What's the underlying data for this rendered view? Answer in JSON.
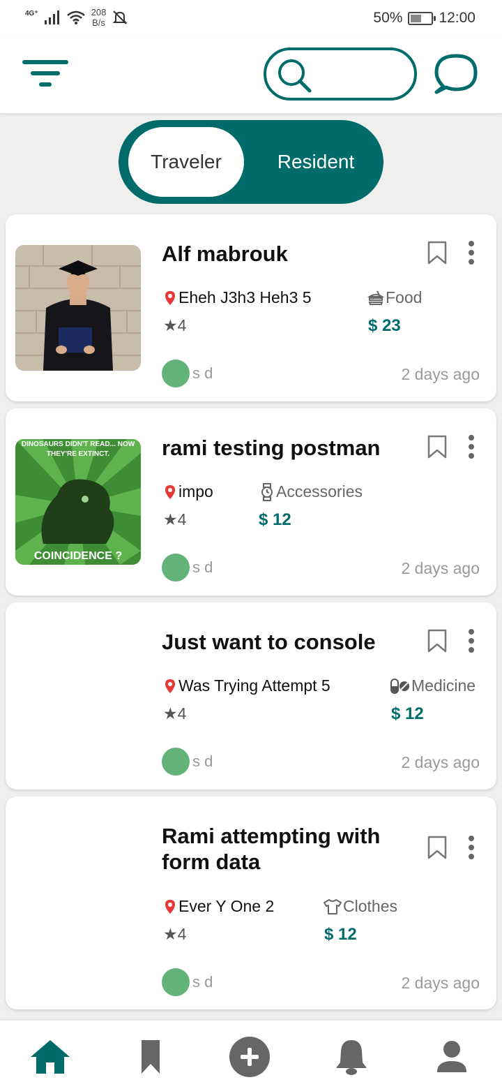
{
  "status_bar": {
    "network": "4G⁺",
    "speed_value": "208",
    "speed_unit": "B/s",
    "battery": "50%",
    "battery_level": 0.5,
    "time": "12:00"
  },
  "header": {
    "filter_icon": "filter-icon",
    "search_icon": "search-icon",
    "search_value": "",
    "chat_icon": "chat-icon"
  },
  "toggle": {
    "options": [
      "Traveler",
      "Resident"
    ],
    "selected": "Traveler"
  },
  "posts": [
    {
      "title": "Alf mabrouk",
      "location": "Eheh J3h3 Heh3 5",
      "category": "Food",
      "category_icon": "food-icon",
      "rating": "★4",
      "price": "$ 23",
      "user": "s d",
      "time": "2 days ago",
      "thumbnail": "graduate-photo"
    },
    {
      "title": "rami testing postman",
      "location": "impo",
      "category": "Accessories",
      "category_icon": "watch-icon",
      "rating": "★4",
      "price": "$ 12",
      "user": "s d",
      "time": "2 days ago",
      "thumbnail": "meme-image",
      "meme_top": "DINOSAURS DIDN'T READ... NOW THEY'RE EXTINCT.",
      "meme_bottom": "COINCIDENCE ?"
    },
    {
      "title": "Just want to console",
      "location": "Was Trying Attempt 5",
      "category": "Medicine",
      "category_icon": "pill-icon",
      "rating": "★4",
      "price": "$ 12",
      "user": "s d",
      "time": "2 days ago"
    },
    {
      "title": "Rami attempting with form data",
      "location": "Ever Y One 2",
      "category": "Clothes",
      "category_icon": "shirt-icon",
      "rating": "★4",
      "price": "$ 12",
      "user": "s d",
      "time": "2 days ago"
    }
  ],
  "bottom_nav": [
    {
      "name": "home",
      "icon": "home-icon",
      "active": true
    },
    {
      "name": "saved",
      "icon": "bookmark-icon",
      "active": false
    },
    {
      "name": "add",
      "icon": "add-icon",
      "active": false
    },
    {
      "name": "notifications",
      "icon": "bell-icon",
      "active": false
    },
    {
      "name": "profile",
      "icon": "profile-icon",
      "active": false
    }
  ],
  "colors": {
    "accent": "#006b6b",
    "pin": "#e53935",
    "avatar": "#63b27a",
    "muted_icon": "#666666"
  }
}
